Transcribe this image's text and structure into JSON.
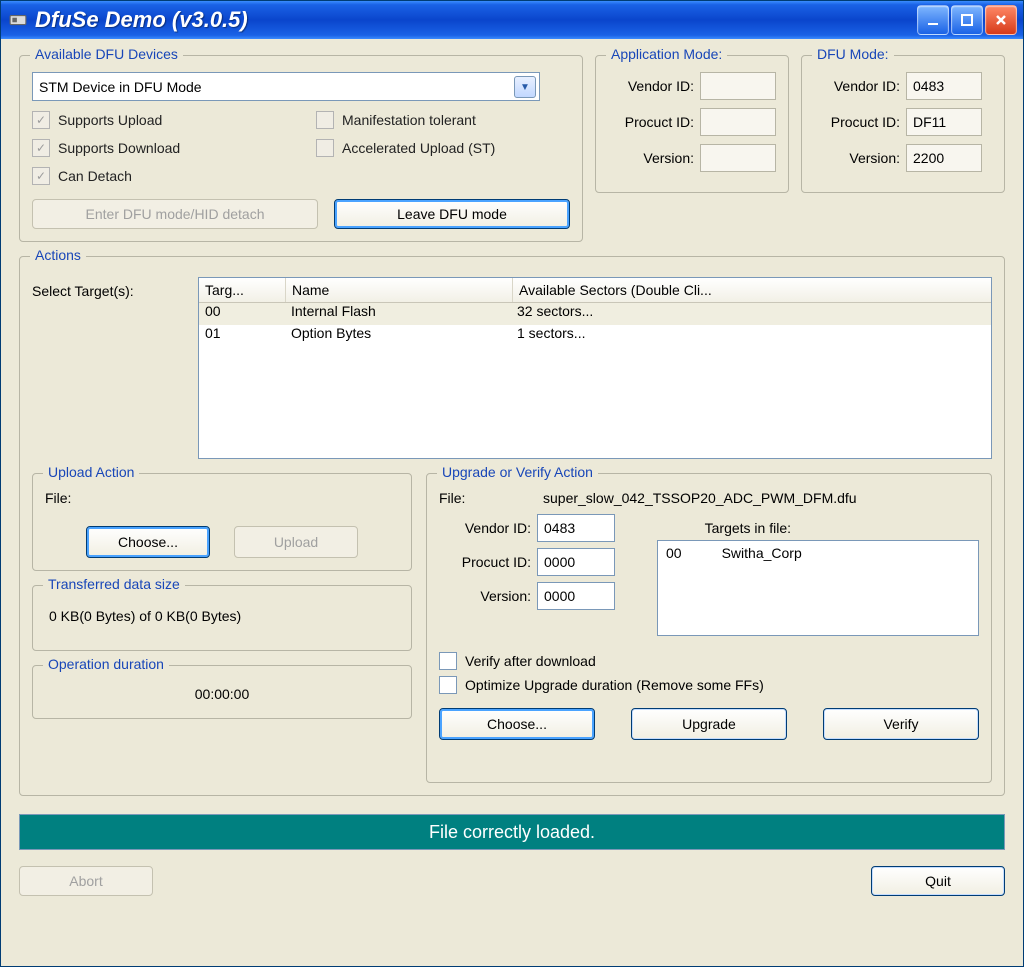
{
  "window": {
    "title": "DfuSe Demo (v3.0.5)"
  },
  "devices": {
    "legend": "Available DFU Devices",
    "selected": "STM Device in DFU Mode",
    "caps": {
      "supports_upload": "Supports Upload",
      "supports_download": "Supports Download",
      "can_detach": "Can Detach",
      "manifest_tolerant": "Manifestation tolerant",
      "accel_upload": "Accelerated Upload (ST)"
    },
    "enter_btn": "Enter DFU mode/HID detach",
    "leave_btn": "Leave DFU mode"
  },
  "app_mode": {
    "legend": "Application Mode:",
    "vendor_label": "Vendor ID:",
    "product_label": "Procuct ID:",
    "version_label": "Version:",
    "vendor": "",
    "product": "",
    "version": ""
  },
  "dfu_mode": {
    "legend": "DFU Mode:",
    "vendor_label": "Vendor ID:",
    "product_label": "Procuct ID:",
    "version_label": "Version:",
    "vendor": "0483",
    "product": "DF11",
    "version": "2200"
  },
  "actions": {
    "legend": "Actions",
    "select_label": "Select Target(s):",
    "headers": {
      "c1": "Targ...",
      "c2": "Name",
      "c3": "Available Sectors (Double Cli..."
    },
    "rows": [
      {
        "id": "00",
        "name": "Internal Flash",
        "sectors": "32 sectors..."
      },
      {
        "id": "01",
        "name": "Option Bytes",
        "sectors": "1 sectors..."
      }
    ]
  },
  "upload": {
    "legend": "Upload Action",
    "file_label": "File:",
    "choose": "Choose...",
    "upload": "Upload"
  },
  "transferred": {
    "legend": "Transferred data size",
    "text": "0 KB(0 Bytes) of 0 KB(0 Bytes)"
  },
  "duration": {
    "legend": "Operation duration",
    "text": "00:00:00"
  },
  "upgrade": {
    "legend": "Upgrade or Verify Action",
    "file_label": "File:",
    "file_value": "super_slow_042_TSSOP20_ADC_PWM_DFM.dfu",
    "vendor_label": "Vendor ID:",
    "vendor": "0483",
    "product_label": "Procuct ID:",
    "product": "0000",
    "version_label": "Version:",
    "version": "0000",
    "targets_label": "Targets in file:",
    "targets": [
      {
        "id": "00",
        "name": "Switha_Corp"
      }
    ],
    "verify_after": "Verify after download",
    "optimize": "Optimize Upgrade duration (Remove some FFs)",
    "choose": "Choose...",
    "upgrade": "Upgrade",
    "verify": "Verify"
  },
  "status": "File correctly loaded.",
  "bottom": {
    "abort": "Abort",
    "quit": "Quit"
  }
}
